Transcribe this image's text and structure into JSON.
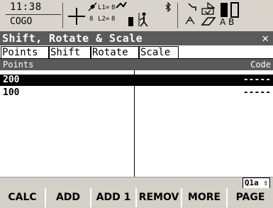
{
  "status": {
    "time": "11:38",
    "app": "COGO",
    "l1_label": "L1=",
    "l1_value": "8",
    "l2_label": "L2=",
    "l2_value": "8",
    "sat_count": "8",
    "abc_label": "A B"
  },
  "window": {
    "title": "Shift, Rotate & Scale",
    "close_glyph": "✕"
  },
  "tabs": [
    {
      "label": "Points"
    },
    {
      "label": "Shift"
    },
    {
      "label": "Rotate"
    },
    {
      "label": "Scale"
    }
  ],
  "table": {
    "headers": {
      "points": "Points",
      "code": "Code"
    },
    "rows": [
      {
        "point": "200",
        "code": "-----",
        "selected": true
      },
      {
        "point": "100",
        "code": "-----",
        "selected": false
      }
    ]
  },
  "input_mode": "Q1a ⇧",
  "softkeys": [
    {
      "label": "CALC"
    },
    {
      "label": "ADD"
    },
    {
      "label": "ADD 1"
    },
    {
      "label": "REMOV"
    },
    {
      "label": "MORE"
    },
    {
      "label": "PAGE"
    }
  ],
  "colors": {
    "title_bg": "#5a5a5a",
    "selected_row_bg": "#000000",
    "body_bg": "#ffffff",
    "chrome_bg": "#d4d0c8"
  }
}
